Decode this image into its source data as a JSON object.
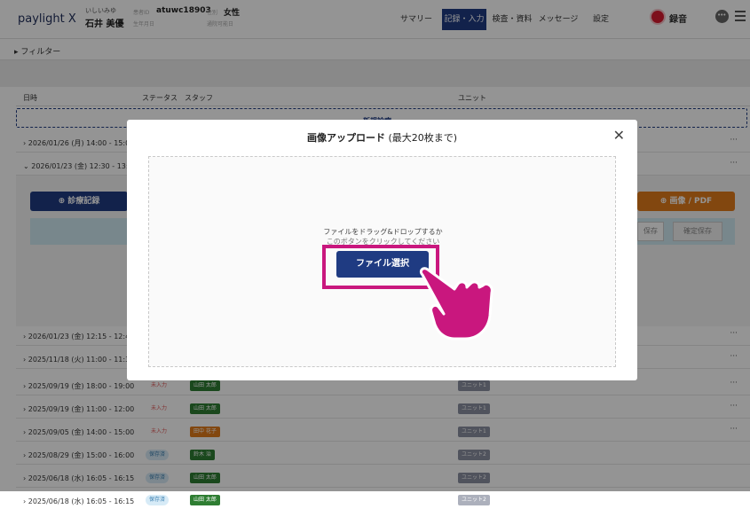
{
  "header": {
    "logo": "paylight X",
    "patient_kana": "いしいみゆ",
    "patient_name": "石井 美優",
    "id_label": "患者ID",
    "id_value": "atuwc18903",
    "sex_label": "性別",
    "sex_value": "女性",
    "dob_label": "生年月日",
    "contact_label": "通院可能日",
    "nav": [
      "サマリー",
      "記録・入力",
      "検査・資料",
      "メッセージ",
      "設定"
    ],
    "active_nav": "記録・入力",
    "record_label": "録音"
  },
  "filter": {
    "label": "▸ フィルター"
  },
  "table": {
    "headers": {
      "date": "日時",
      "status": "ステータス",
      "staff": "スタッフ",
      "unit": "ユニット"
    },
    "new_entry": "新規診療",
    "rows_top": [
      {
        "date": "2026/01/26 (月) 14:00 - 15:0",
        "chevron": "›"
      },
      {
        "date": "2026/01/23 (金) 12:30 - 13:0",
        "chevron": "⌄"
      }
    ],
    "expanded": {
      "btn_record": "⊕ 診療記録",
      "btn_image": "⊕ 画像 / PDF",
      "btn_save": "保存",
      "btn_confirm": "確定保存"
    },
    "rows": [
      {
        "date": "2026/01/23 (金) 12:15 - 12:4",
        "status": "",
        "staff": "",
        "unit": ""
      },
      {
        "date": "2025/11/18 (火) 11:00 - 11:3",
        "status": "",
        "staff": "",
        "unit": ""
      },
      {
        "date": "2025/09/19 (金) 18:00 - 19:00",
        "status": "未入力",
        "staff": "山田 太郎",
        "unit": "ユニット1"
      },
      {
        "date": "2025/09/19 (金) 11:00 - 12:00",
        "status": "未入力",
        "staff": "山田 太郎",
        "unit": "ユニット1"
      },
      {
        "date": "2025/09/05 (金) 14:00 - 15:00",
        "status": "未入力",
        "staff": "田中 花子",
        "unit": "ユニット1"
      },
      {
        "date": "2025/08/29 (金) 15:00 - 16:00",
        "status": "保存済",
        "staff": "鈴木 治",
        "unit": "ユニット2"
      },
      {
        "date": "2025/06/18 (水) 16:05 - 16:15",
        "status": "保存済",
        "staff": "山田 太郎",
        "unit": "ユニット2"
      },
      {
        "date": "2025/06/18 (水) 16:05 - 16:15",
        "status": "保存済",
        "staff": "山田 太郎",
        "unit": "ユニット2"
      }
    ],
    "more": "···"
  },
  "modal": {
    "title": "画像アップロード",
    "title_note": "(最大20枚まで)",
    "close": "✕",
    "drop_text_1": "ファイルをドラッグ&ドロップするか",
    "drop_text_2": "このボタンをクリックしてください",
    "file_button": "ファイル選択"
  },
  "colors": {
    "primary": "#1f3b82",
    "accent_highlight": "#c9177e",
    "record_red": "#d81b30",
    "orange": "#e07a1a"
  }
}
